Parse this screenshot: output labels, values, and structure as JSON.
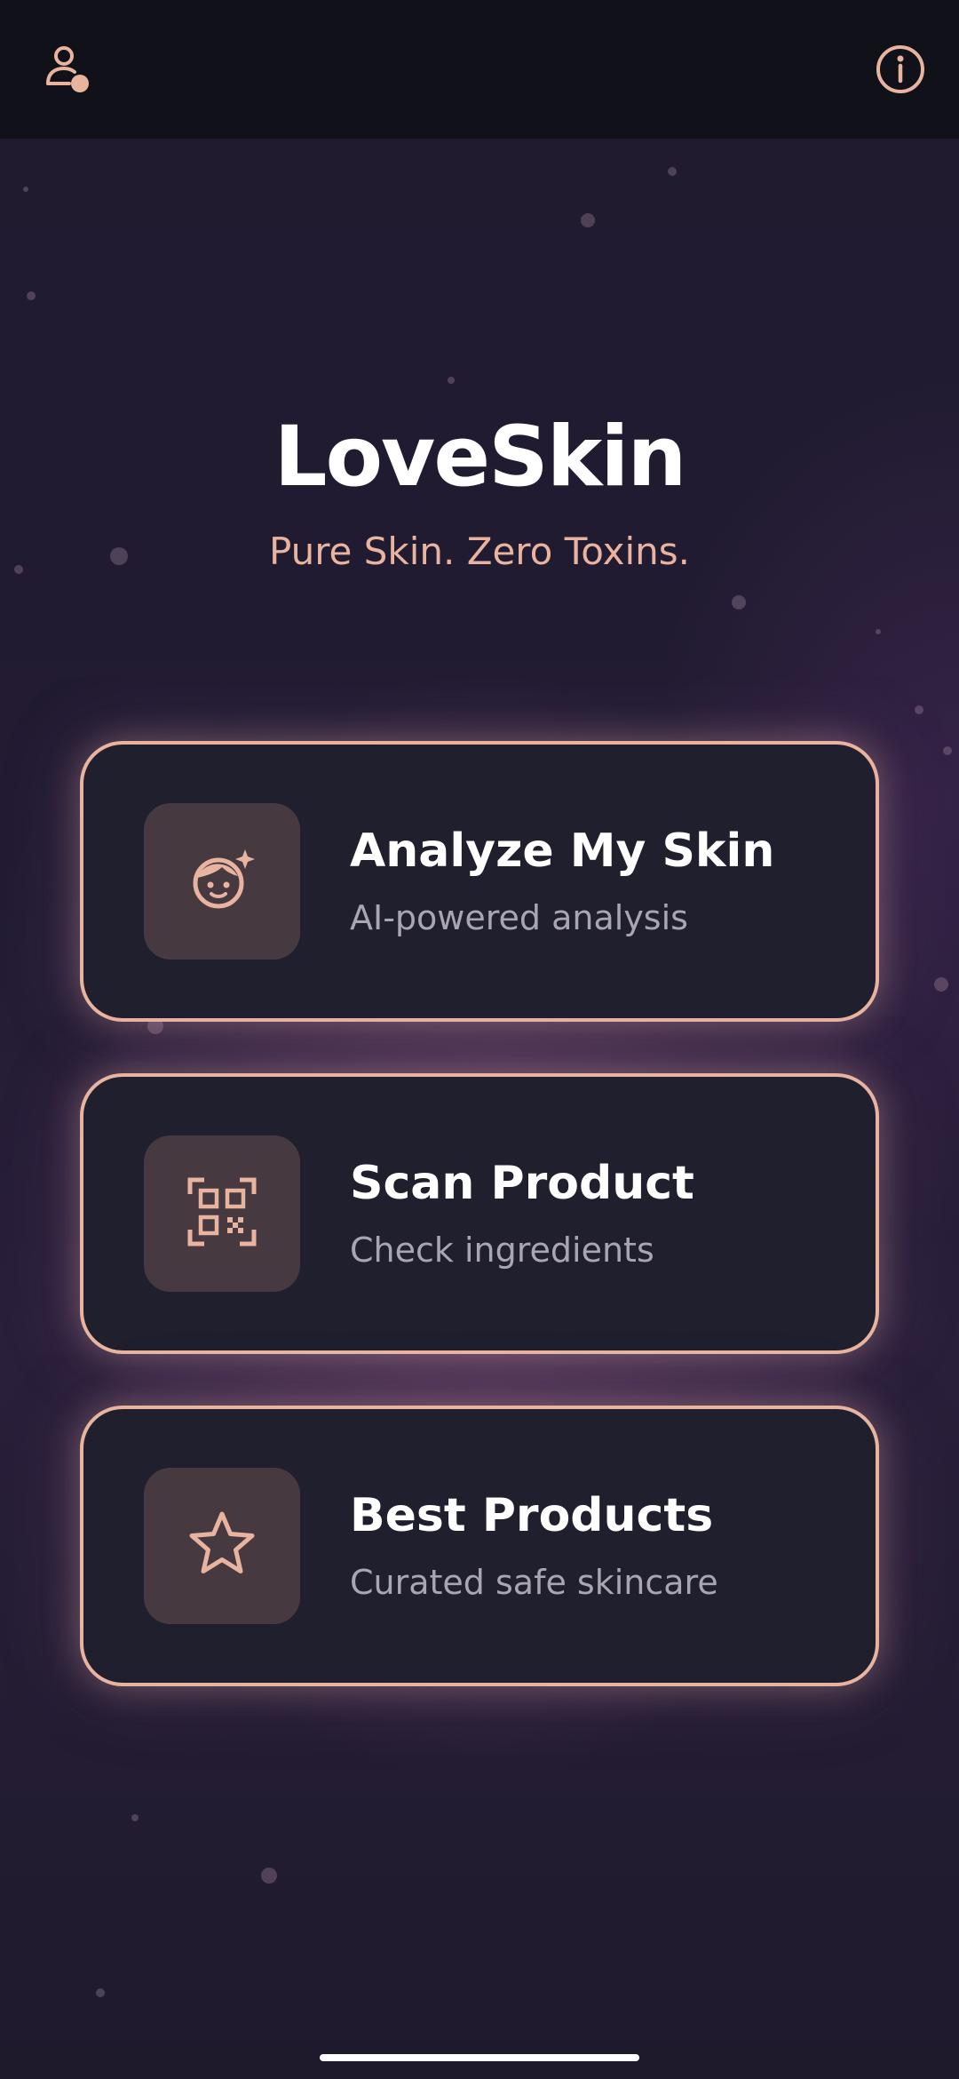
{
  "app": {
    "title": "LoveSkin",
    "tagline": "Pure Skin. Zero Toxins."
  },
  "header": {
    "left_icon": "user-settings-icon",
    "right_icon": "info-icon"
  },
  "cards": [
    {
      "title": "Analyze My Skin",
      "subtitle": "AI-powered analysis",
      "icon": "face-sparkle-icon"
    },
    {
      "title": "Scan Product",
      "subtitle": "Check ingredients",
      "icon": "qr-scan-icon"
    },
    {
      "title": "Best Products",
      "subtitle": "Curated safe skincare",
      "icon": "star-icon"
    }
  ],
  "colors": {
    "accent": "#e8b4a0",
    "card_bg": "#201f2e",
    "icon_tile_bg": "#46393f",
    "top_bar_bg": "#111119",
    "title_text": "#ffffff",
    "subtitle_text": "#a9a6b2"
  }
}
